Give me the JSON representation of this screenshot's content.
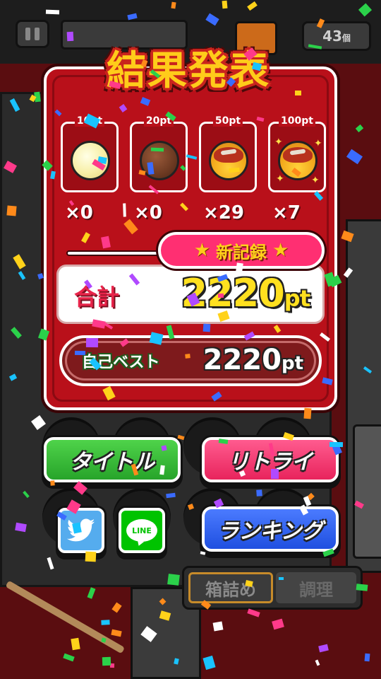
{
  "title": "結果発表",
  "header": {
    "top_counter": "43",
    "top_counter_unit": "個"
  },
  "items": [
    {
      "pt_label": "10pt",
      "count": "×0",
      "icon": "plain-ball-icon"
    },
    {
      "pt_label": "20pt",
      "count": "×0",
      "icon": "choco-ball-icon"
    },
    {
      "pt_label": "50pt",
      "count": "×29",
      "icon": "takoyaki-icon"
    },
    {
      "pt_label": "100pt",
      "count": "×7",
      "icon": "golden-takoyaki-icon"
    }
  ],
  "new_record": "新記録",
  "total": {
    "label": "合計",
    "value": "2220",
    "unit": "pt"
  },
  "best": {
    "label": "自己ベスト",
    "value": "2220",
    "unit": "pt"
  },
  "buttons": {
    "title": "タイトル",
    "retry": "リトライ",
    "ranking": "ランキング",
    "line": "LINE"
  },
  "tabs": {
    "packing": "箱詰め",
    "cooking": "調理"
  },
  "colors": {
    "panel": "#b9101a",
    "title_yellow": "#ffcc1a",
    "green_button": "#27a42a",
    "pink_button": "#e8245c",
    "blue_button": "#1f4fe0"
  }
}
